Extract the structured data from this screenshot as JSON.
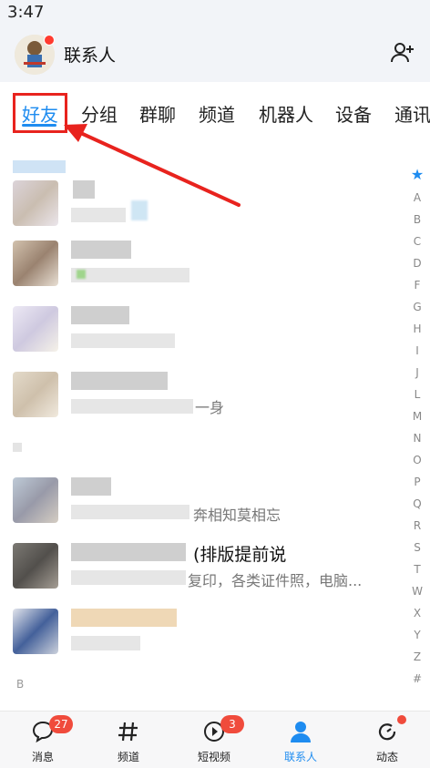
{
  "status_bar": {
    "time": "3:47"
  },
  "header": {
    "title": "联系人"
  },
  "tabs": [
    {
      "label": "好友",
      "active": true
    },
    {
      "label": "分组"
    },
    {
      "label": "群聊"
    },
    {
      "label": "频道"
    },
    {
      "label": "机器人"
    },
    {
      "label": "设备"
    },
    {
      "label": "通讯"
    }
  ],
  "friends": [
    {
      "snippet": "一身"
    },
    {
      "snippet": "奔相知莫相忘"
    },
    {
      "name": "(排版提前说",
      "snippet": "复印，各类证件照，电脑..."
    }
  ],
  "section_b": "B",
  "index": [
    "★",
    "A",
    "B",
    "C",
    "D",
    "F",
    "G",
    "H",
    "I",
    "J",
    "L",
    "M",
    "N",
    "O",
    "P",
    "Q",
    "R",
    "S",
    "T",
    "W",
    "X",
    "Y",
    "Z",
    "#"
  ],
  "bottom_nav": [
    {
      "label": "消息",
      "badge": "27"
    },
    {
      "label": "频道"
    },
    {
      "label": "短视频",
      "badge": "3"
    },
    {
      "label": "联系人",
      "active": true
    },
    {
      "label": "动态",
      "dot": true
    }
  ],
  "colors": {
    "accent": "#1e8cf0",
    "badge": "#f04b3c",
    "highlight": "#e8231e"
  }
}
